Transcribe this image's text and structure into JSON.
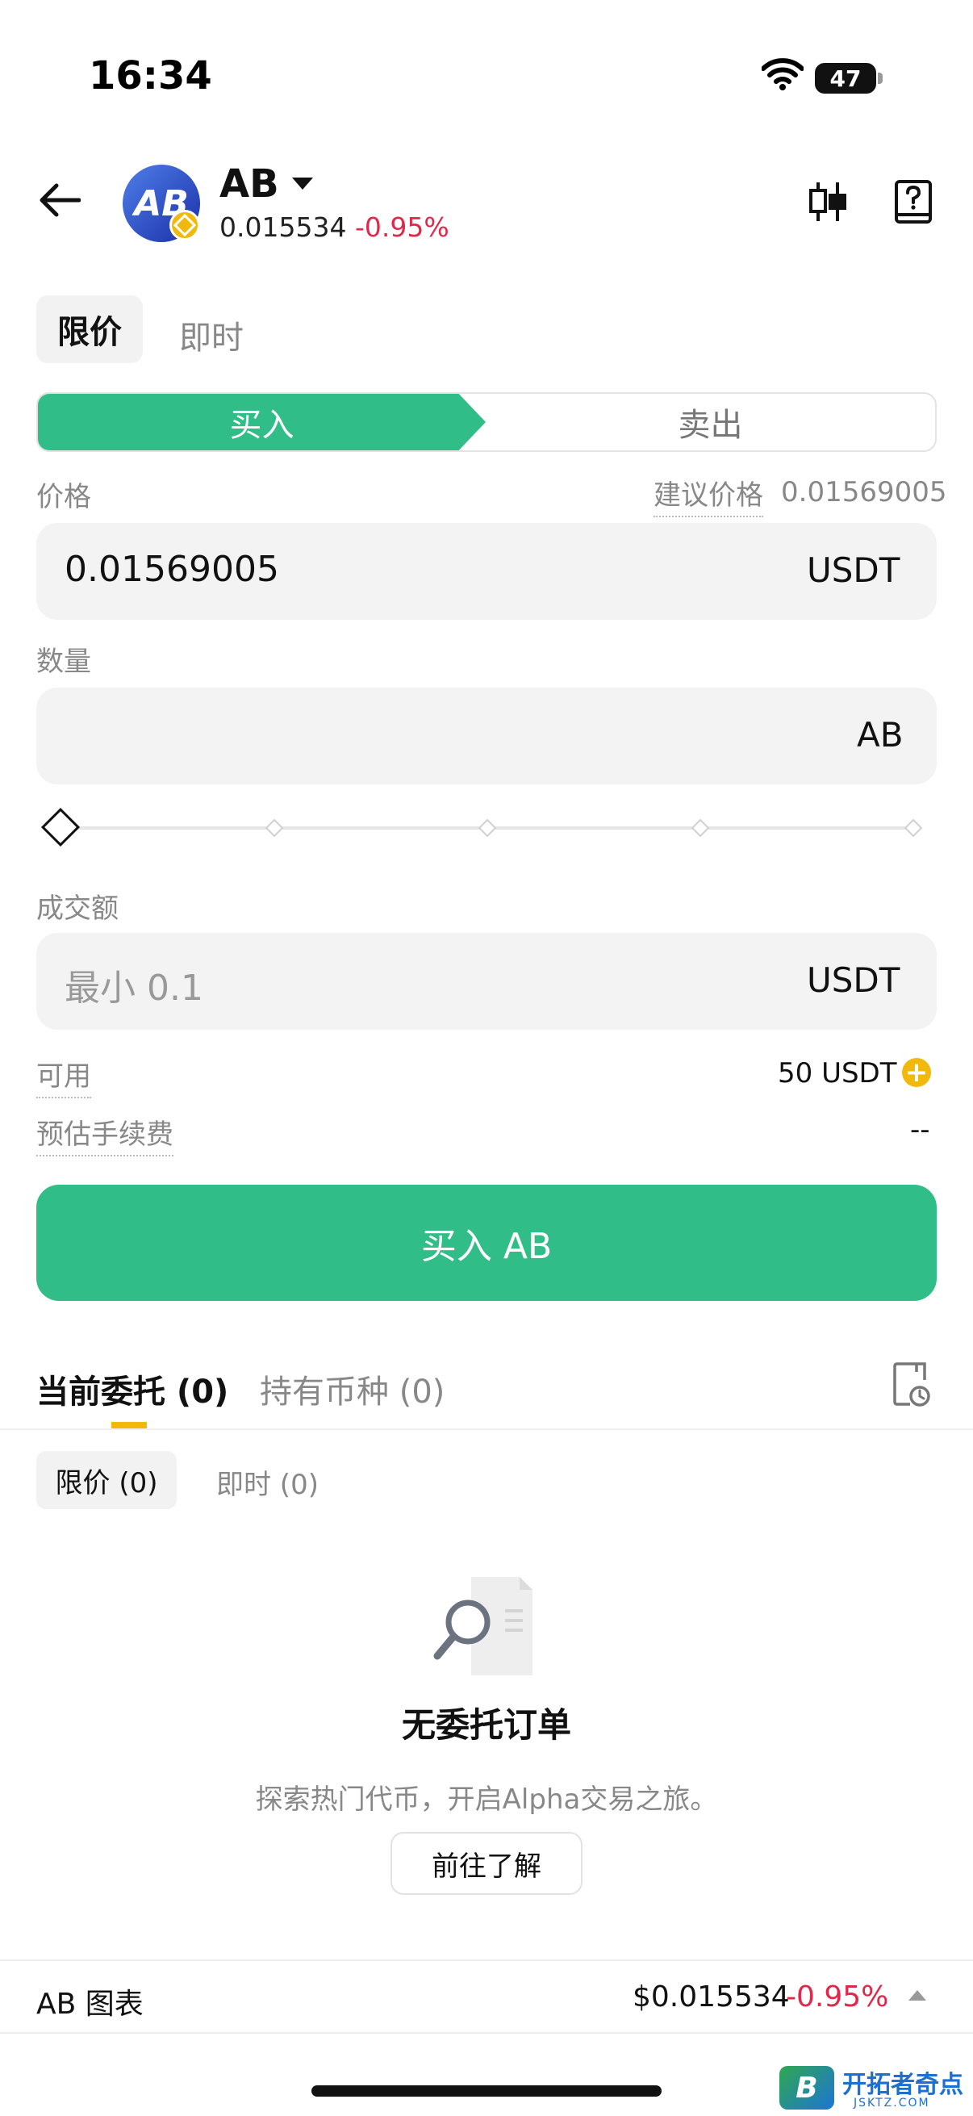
{
  "status_bar": {
    "time": "16:34",
    "battery": "47"
  },
  "header": {
    "token": "AB",
    "price": "0.015534",
    "change": "-0.95%",
    "logo_text": "AB"
  },
  "order_type": {
    "limit": "限价",
    "market": "即时"
  },
  "side": {
    "buy": "买入",
    "sell": "卖出"
  },
  "price_field": {
    "label": "价格",
    "suggest_label": "建议价格",
    "suggest_value": "0.01569005",
    "value": "0.01569005",
    "unit": "USDT"
  },
  "quantity_field": {
    "label": "数量",
    "value": "",
    "unit": "AB"
  },
  "slider": {
    "value_percent": 0
  },
  "amount_field": {
    "label": "成交额",
    "placeholder": "最小 0.1",
    "unit": "USDT"
  },
  "available": {
    "label": "可用",
    "value": "50 USDT"
  },
  "fee": {
    "label": "预估手续费",
    "value": "--"
  },
  "submit": {
    "label": "买入 AB"
  },
  "orders": {
    "tab_open": "当前委托 (0)",
    "tab_holdings": "持有币种 (0)",
    "sub_limit": "限价 (0)",
    "sub_market": "即时 (0)",
    "empty_title": "无委托订单",
    "empty_desc": "探索热门代币，开启Alpha交易之旅。",
    "learn_btn": "前往了解"
  },
  "chart_bar": {
    "label": "AB 图表",
    "price": "$0.015534",
    "change": "-0.95%"
  },
  "watermark": {
    "icon_letter": "B",
    "text": "开拓者奇点",
    "sub": "JSKTZ.COM"
  },
  "colors": {
    "buy": "#31bd87",
    "down": "#e0294a",
    "accent": "#f0b90b"
  }
}
